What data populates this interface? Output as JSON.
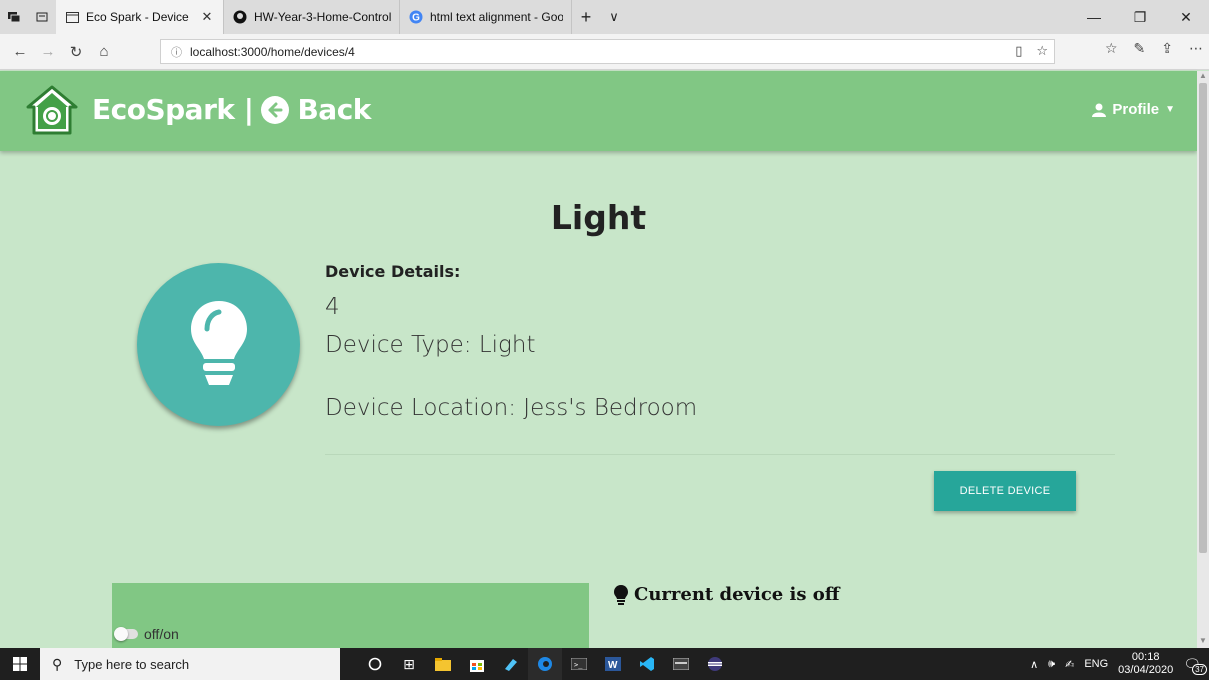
{
  "browser": {
    "tabs": [
      {
        "title": "Eco Spark - Device",
        "active": true
      },
      {
        "title": "HW-Year-3-Home-Control-I",
        "active": false
      },
      {
        "title": "html text alignment - Googl",
        "active": false
      }
    ],
    "new_tab": "+",
    "tab_list": "∨",
    "url": "localhost:3000/home/devices/4"
  },
  "header": {
    "brand": "EcoSpark |",
    "back_label": "Back",
    "profile_label": "Profile"
  },
  "device": {
    "title": "Light",
    "details_label": "Device Details:",
    "id": "4",
    "type_text": "Device Type: Light",
    "location_text": "Device Location: Jess's Bedroom",
    "delete_label": "DELETE DEVICE",
    "toggle_label": "off/on",
    "status_text": "Current device is off",
    "is_on": false
  },
  "taskbar": {
    "search_placeholder": "Type here to search",
    "language": "ENG",
    "time": "00:18",
    "date": "03/04/2020",
    "notification_count": "37"
  },
  "colors": {
    "page_bg": "#c8e6c9",
    "header_bg": "#81c784",
    "accent": "#26a69a",
    "avatar_bg": "#4db6ac"
  }
}
